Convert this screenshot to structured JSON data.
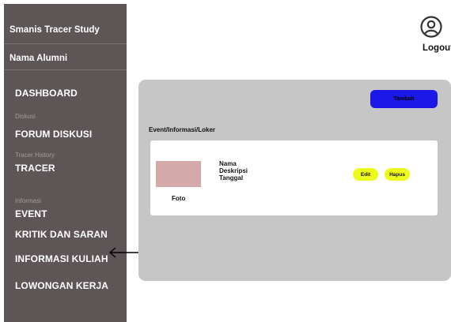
{
  "sidebar": {
    "brand": "Smanis Tracer Study",
    "alumni": "Nama Alumni",
    "dashboard": "DASHBOARD",
    "section_diskusi": "Diskusi",
    "forum": "FORUM DISKUSI",
    "section_tracer": "Tracer History",
    "tracer": "TRACER",
    "section_informasi": "Informasi",
    "event": "EVENT",
    "kritik": "KRITIK DAN SARAN",
    "kuliah": "INFORMASI KULIAH",
    "loker": "LOWONGAN KERJA"
  },
  "header": {
    "avatar_icon": "user-circle-icon",
    "logout": "Logout"
  },
  "main": {
    "add_button": "Tambah",
    "panel_title": "Event/Informasi/Loker",
    "card": {
      "photo_label": "Foto",
      "name": "Nama",
      "description": "Deskripsi",
      "date": "Tanggal",
      "edit_button": "Edit",
      "delete_button": "Hapus"
    }
  },
  "annotation": {
    "arrow_icon": "left-arrow-icon"
  },
  "colors": {
    "sidebar_bg": "#5e5656",
    "panel_bg": "#c6c6c6",
    "primary_button": "#1b18e8",
    "action_button": "#ecfb1a",
    "photo_placeholder": "#d4a9aa"
  }
}
